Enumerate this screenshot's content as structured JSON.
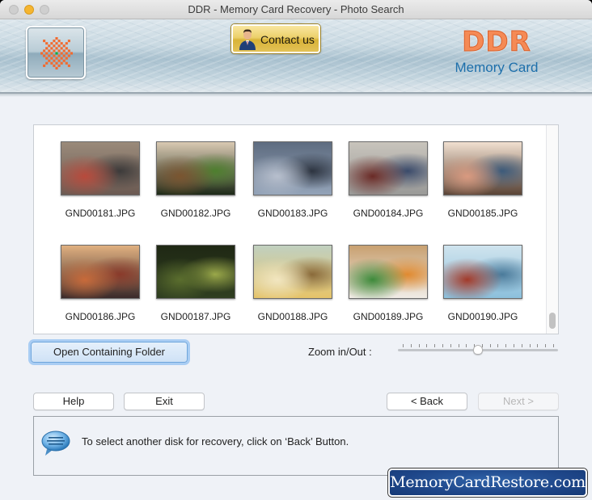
{
  "window": {
    "title": "DDR - Memory Card Recovery - Photo Search"
  },
  "banner": {
    "contact_label": "Contact us",
    "brand_title": "DDR",
    "brand_subtitle": "Memory Card",
    "colors": {
      "brand_orange": "#f58a55",
      "brand_blue": "#1d6fab"
    }
  },
  "photos": [
    {
      "name": "GND00181.JPG",
      "scene": "street-market",
      "colors": [
        "#6b5a52",
        "#b84a3c",
        "#3c3a3a",
        "#9a8a7a"
      ]
    },
    {
      "name": "GND00182.JPG",
      "scene": "child-with-teddy",
      "colors": [
        "#1d2a18",
        "#7a5530",
        "#4e7f2e",
        "#d9c9b2"
      ]
    },
    {
      "name": "GND00183.JPG",
      "scene": "beach-silhouettes",
      "colors": [
        "#93a3b8",
        "#b7bfcd",
        "#2d3440",
        "#5e6c80"
      ]
    },
    {
      "name": "GND00184.JPG",
      "scene": "friends-on-steps",
      "colors": [
        "#9a9a98",
        "#6a2a26",
        "#3a4a6a",
        "#c8c4bc"
      ]
    },
    {
      "name": "GND00185.JPG",
      "scene": "family-meeting",
      "colors": [
        "#5a4436",
        "#d99a80",
        "#3c5a7a",
        "#f1e0d0"
      ]
    },
    {
      "name": "GND00186.JPG",
      "scene": "dinner-party",
      "colors": [
        "#3a2a2a",
        "#c86a3a",
        "#8a3a2a",
        "#e0b080"
      ]
    },
    {
      "name": "GND00187.JPG",
      "scene": "cycling-in-park",
      "colors": [
        "#2f3e20",
        "#5b6e2e",
        "#9aa84a",
        "#1f2814"
      ]
    },
    {
      "name": "GND00188.JPG",
      "scene": "cafe-interior",
      "colors": [
        "#e6c46a",
        "#f2e6c0",
        "#8a6a3a",
        "#c0d0c0"
      ]
    },
    {
      "name": "GND00189.JPG",
      "scene": "kids-yoga",
      "colors": [
        "#f0ece6",
        "#3d8a3a",
        "#e08a30",
        "#c8a070"
      ]
    },
    {
      "name": "GND00190.JPG",
      "scene": "golden-gate-bridge",
      "colors": [
        "#8cc0dc",
        "#a23a2a",
        "#4a7a9a",
        "#d0e4ee"
      ]
    }
  ],
  "controls": {
    "open_folder_label": "Open Containing Folder",
    "zoom_label": "Zoom in/Out :",
    "zoom_level": 0.5,
    "zoom_ticks": 20
  },
  "nav": {
    "help_label": "Help",
    "exit_label": "Exit",
    "back_label": "< Back",
    "next_label": "Next >"
  },
  "status": {
    "message": "To select another disk for recovery, click on ‘Back’ Button."
  },
  "watermark": {
    "text": "MemoryCardRestore.com"
  }
}
